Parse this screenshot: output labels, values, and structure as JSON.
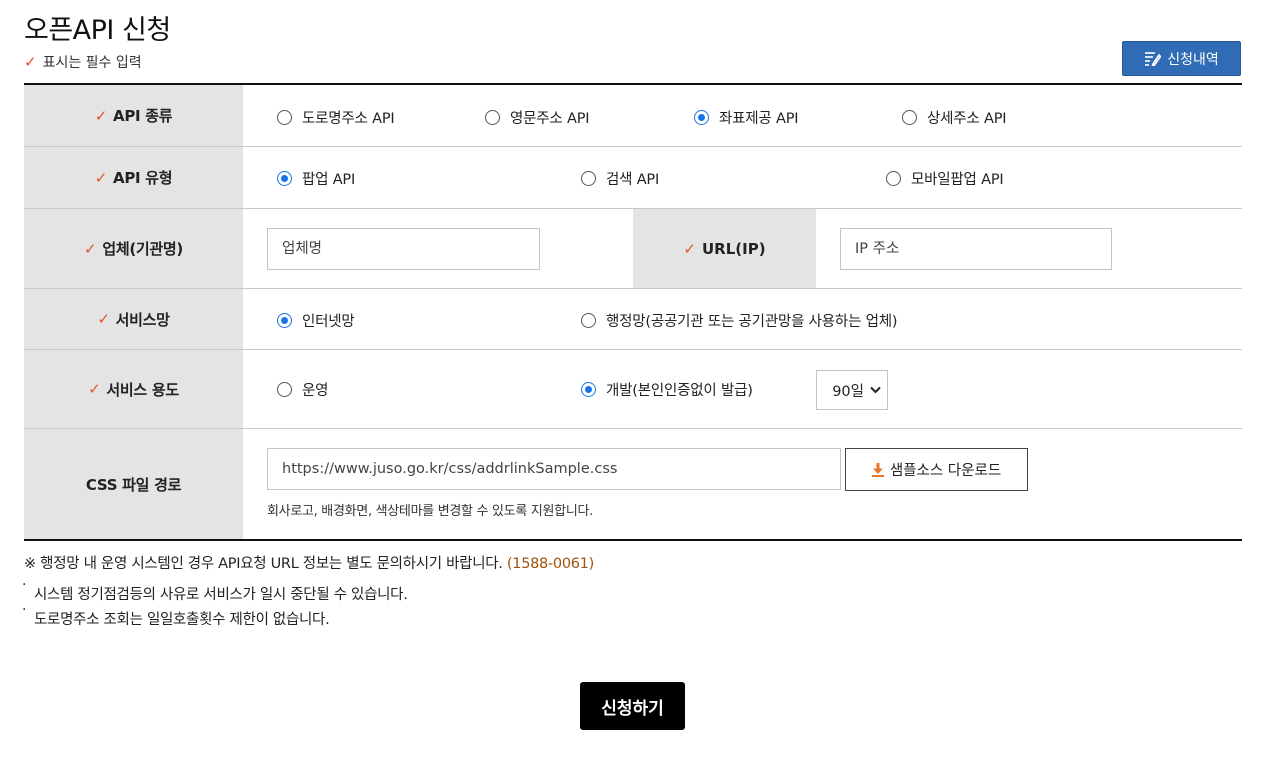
{
  "header": {
    "title": "오픈API 신청",
    "required_note": "표시는 필수 입력",
    "history_button": "신청내역"
  },
  "form": {
    "api_type": {
      "label": "API 종류",
      "options": [
        "도로명주소 API",
        "영문주소 API",
        "좌표제공 API",
        "상세주소 API"
      ],
      "selected": "좌표제공 API"
    },
    "api_kind": {
      "label": "API 유형",
      "options": [
        "팝업 API",
        "검색 API",
        "모바일팝업 API"
      ],
      "selected": "팝업 API"
    },
    "company": {
      "label": "업체(기관명)",
      "placeholder": "업체명",
      "url_label": "URL(IP)",
      "url_placeholder": "IP 주소"
    },
    "service_network": {
      "label": "서비스망",
      "options": [
        "인터넷망",
        "행정망(공공기관 또는 공기관망을 사용하는 업체)"
      ],
      "selected": "인터넷망"
    },
    "service_usage": {
      "label": "서비스 용도",
      "options": [
        "운영",
        "개발(본인인증없이 발급)"
      ],
      "selected": "개발(본인인증없이 발급)",
      "period": "90일"
    },
    "css_path": {
      "label": "CSS 파일 경로",
      "placeholder": "https://www.juso.go.kr/css/addrlinkSample.css",
      "download_button": "샘플소스 다운로드",
      "helper": "회사로고, 배경화면, 색상테마를 변경할 수 있도록 지원합니다."
    }
  },
  "notes": {
    "notice": "※ 행정망 내 운영 시스템인 경우 API요청 URL 정보는 별도 문의하시기 바랍니다.",
    "phone": "(1588-0061)",
    "bullets": [
      "시스템 정기점검등의 사유로 서비스가 일시 중단될 수 있습니다.",
      "도로명주소 조회는 일일호출횟수 제한이 없습니다."
    ]
  },
  "submit_button": "신청하기",
  "colors": {
    "accent_blue": "#2f6cb5",
    "required_mark": "#e8502d",
    "radio_selected": "#1a73e8",
    "phone_text": "#a0520c"
  }
}
